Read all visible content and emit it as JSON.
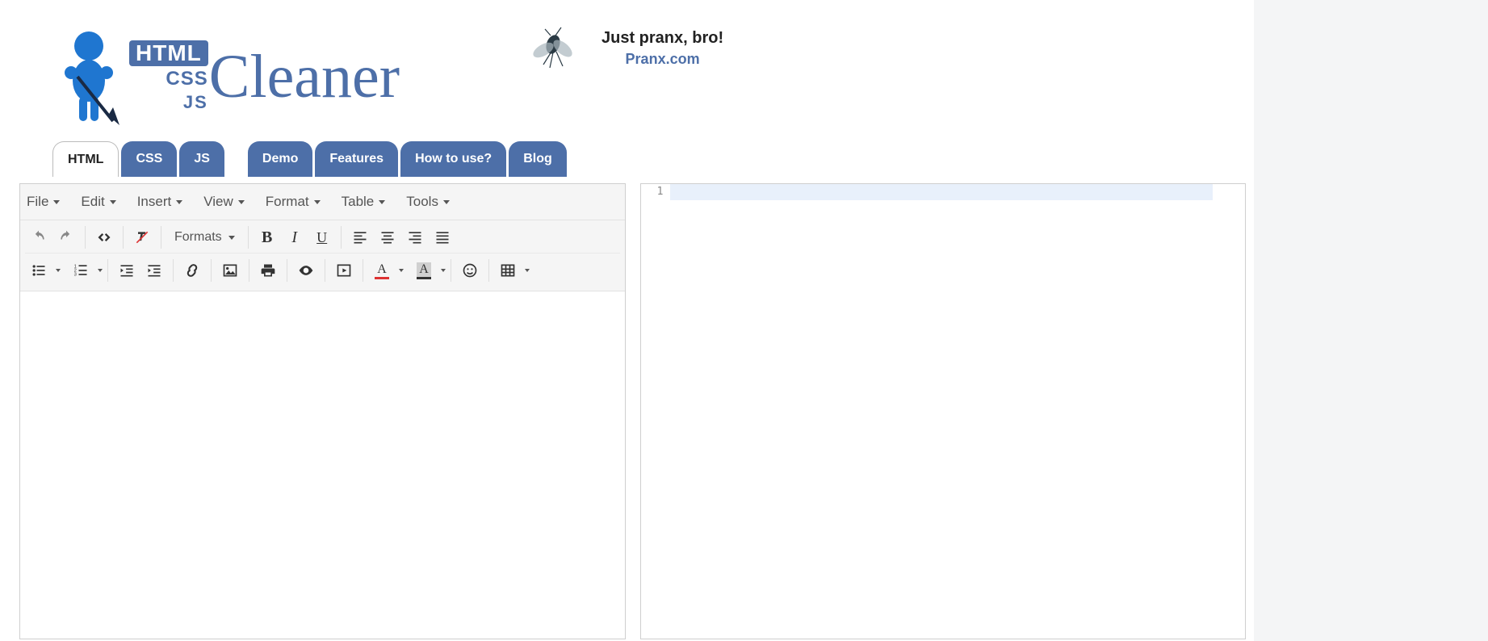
{
  "logo": {
    "html_badge": "HTML",
    "css_label": "CSS",
    "js_label": "JS",
    "cleaner": "Cleaner"
  },
  "ad": {
    "title": "Just pranx, bro!",
    "subtitle": "Pranx.com"
  },
  "tabs": {
    "primary": [
      {
        "label": "HTML",
        "active": true
      },
      {
        "label": "CSS",
        "active": false
      },
      {
        "label": "JS",
        "active": false
      }
    ],
    "nav": [
      {
        "label": "Demo"
      },
      {
        "label": "Features"
      },
      {
        "label": "How to use?"
      },
      {
        "label": "Blog"
      }
    ]
  },
  "editor": {
    "menus": [
      "File",
      "Edit",
      "Insert",
      "View",
      "Format",
      "Table",
      "Tools"
    ],
    "formats_label": "Formats",
    "textcolor_glyph": "A",
    "bgcolor_glyph": "A"
  },
  "code": {
    "line_number": "1",
    "content": ""
  }
}
